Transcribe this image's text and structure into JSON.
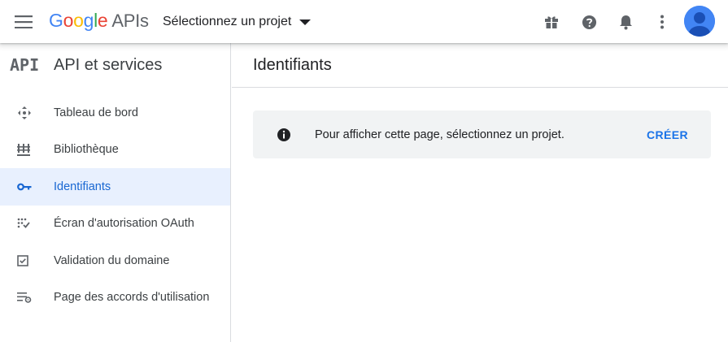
{
  "header": {
    "logo_google": "Google",
    "logo_apis": "APIs",
    "project_label": "Sélectionnez un projet",
    "icons": [
      "menu-icon",
      "gift-icon",
      "help-icon",
      "notifications-icon",
      "more-vert-icon",
      "account-avatar"
    ]
  },
  "sidebar": {
    "badge": "API",
    "title": "API et services",
    "items": [
      {
        "label": "Tableau de bord",
        "icon": "dashboard-icon",
        "active": false
      },
      {
        "label": "Bibliothèque",
        "icon": "library-icon",
        "active": false
      },
      {
        "label": "Identifiants",
        "icon": "key-icon",
        "active": true
      },
      {
        "label": "Écran d'autorisation OAuth",
        "icon": "oauth-consent-icon",
        "active": false
      },
      {
        "label": "Validation du domaine",
        "icon": "checkbox-icon",
        "active": false
      },
      {
        "label": "Page des accords d'utilisation",
        "icon": "settings-list-icon",
        "active": false
      }
    ]
  },
  "main": {
    "title": "Identifiants",
    "notice": {
      "text": "Pour afficher cette page, sélectionnez un projet.",
      "action": "CRÉER"
    }
  },
  "colors": {
    "accent": "#1a73e8",
    "active_bg": "#e8f0fe",
    "notice_bg": "#f1f3f4",
    "divider": "#dadce0"
  }
}
